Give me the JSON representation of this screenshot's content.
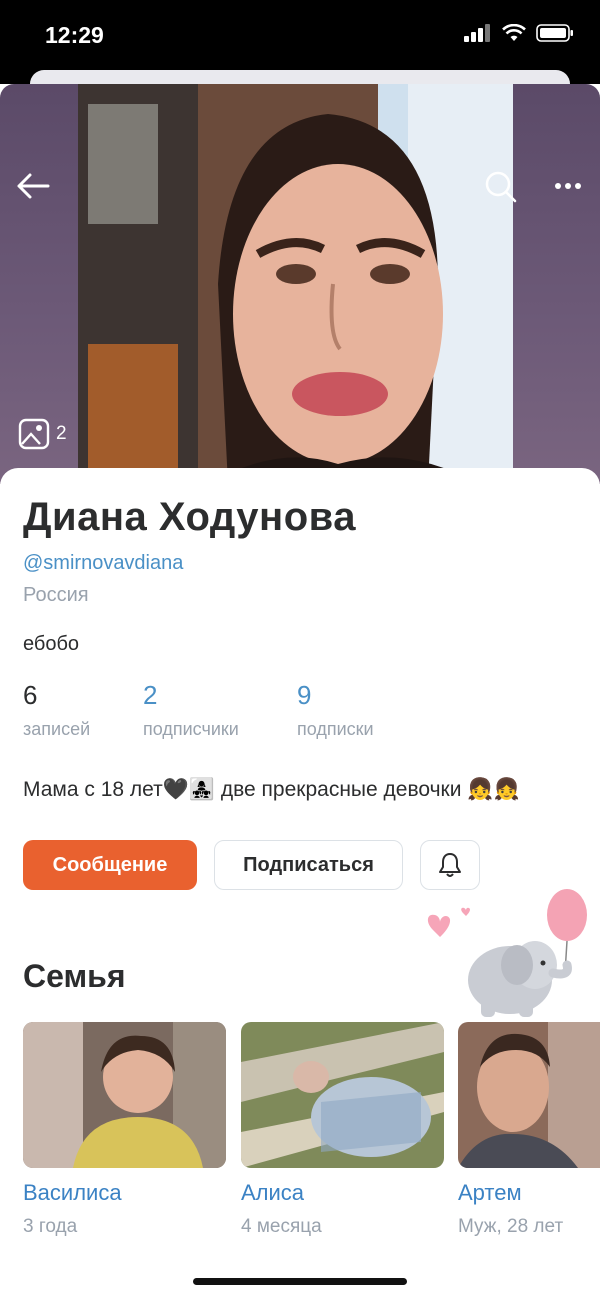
{
  "status_bar": {
    "time": "12:29"
  },
  "cover": {
    "photo_count": "2"
  },
  "profile": {
    "name": "Диана Ходунова",
    "handle": "@smirnovavdiana",
    "country": "Россия",
    "status": "ебобо",
    "stats": [
      {
        "value": "6",
        "label": "записей"
      },
      {
        "value": "2",
        "label": "подписчики"
      },
      {
        "value": "9",
        "label": "подписки"
      }
    ],
    "about": "Мама с 18 лет🖤👩‍👧‍👧 две прекрасные девочки 👧👧"
  },
  "actions": {
    "message": "Сообщение",
    "subscribe": "Подписаться"
  },
  "family": {
    "title": "Семья",
    "members": [
      {
        "name": "Василиса",
        "relation": "3 года"
      },
      {
        "name": "Алиса",
        "relation": "4 месяца"
      },
      {
        "name": "Артем",
        "relation": "Муж, 28 лет"
      }
    ]
  },
  "colors": {
    "accent": "#e9612f",
    "link": "#3b82c4",
    "secondary": "#99a2ad"
  }
}
